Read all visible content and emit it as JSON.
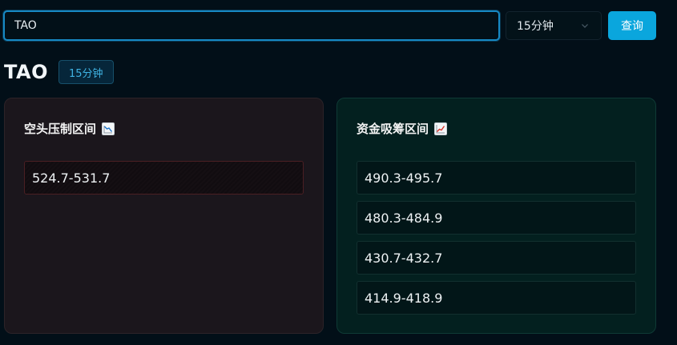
{
  "search": {
    "value": "TAO"
  },
  "interval_select": {
    "selected": "15分钟"
  },
  "query_button": {
    "label": "查询"
  },
  "header": {
    "symbol": "TAO",
    "interval_tag": "15分钟"
  },
  "short_panel": {
    "title": "空头压制区间",
    "icon": "chart-decreasing-icon",
    "accent": "#4b1f23",
    "ranges": [
      "524.7-531.7"
    ]
  },
  "long_panel": {
    "title": "资金吸筹区间",
    "icon": "chart-increasing-icon",
    "accent": "#12302f",
    "ranges": [
      "490.3-495.7",
      "480.3-484.9",
      "430.7-432.7",
      "414.9-418.9"
    ]
  },
  "colors": {
    "background": "#020f18",
    "accent_blue": "#0aa6dd",
    "tag_text": "#3fb2e2"
  }
}
